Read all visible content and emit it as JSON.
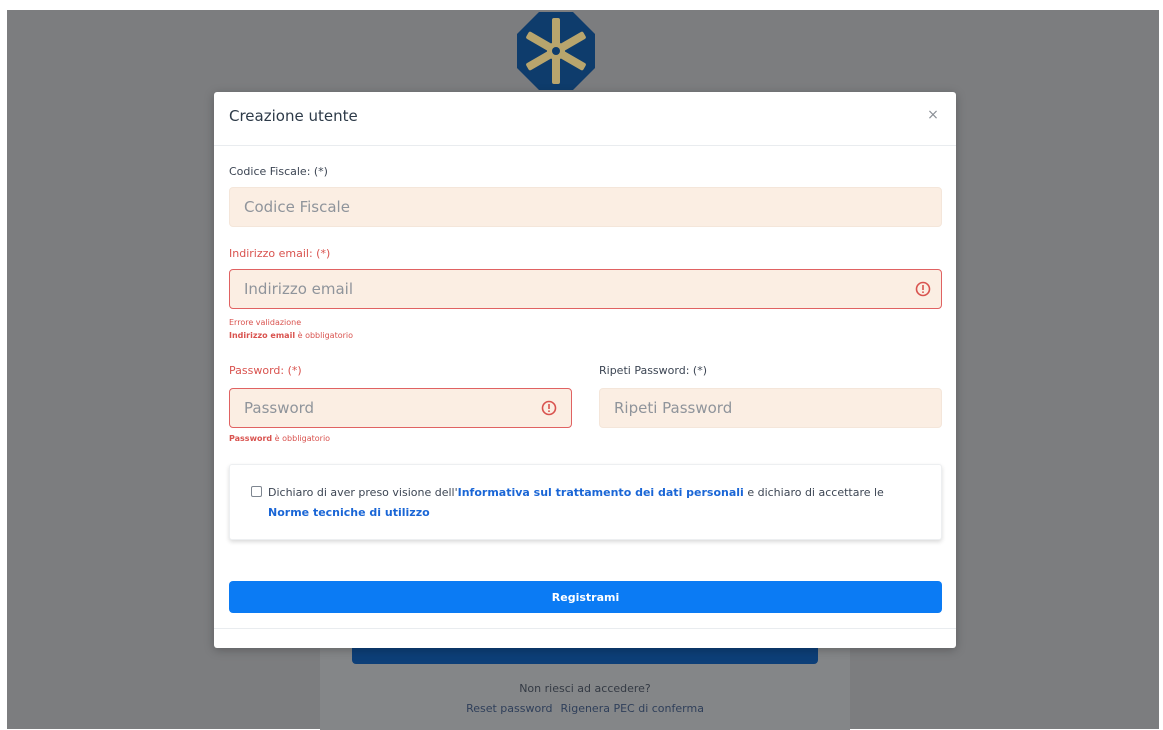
{
  "modal": {
    "title": "Creazione utente",
    "close_label": "×"
  },
  "form": {
    "codice_fiscale": {
      "label": "Codice Fiscale: (*)",
      "placeholder": "Codice Fiscale"
    },
    "email": {
      "label": "Indirizzo email: (*)",
      "placeholder": "Indirizzo email",
      "error_title": "Errore validazione",
      "error_field": "Indirizzo email",
      "error_suffix": " è obbligatorio"
    },
    "password": {
      "label": "Password: (*)",
      "placeholder": "Password",
      "error_field": "Password",
      "error_suffix": " è obbligatorio"
    },
    "repeat_password": {
      "label": "Ripeti Password: (*)",
      "placeholder": "Ripeti Password"
    },
    "consent": {
      "text_1": "Dichiaro di aver preso visione dell'",
      "link_1": "Informativa sul trattamento dei dati personali",
      "text_2": " e dichiaro di accettare le ",
      "link_2": "Norme tecniche di utilizzo"
    },
    "submit_label": "Registrami"
  },
  "background": {
    "prompt": "Non riesci ad accedere?",
    "link_reset": "Reset password",
    "link_pec": "Rigenera PEC di conferma"
  },
  "colors": {
    "accent": "#0b7bf4",
    "error": "#d9534f",
    "input_bg": "#fbeee3",
    "backdrop": "#7c7d7f"
  }
}
